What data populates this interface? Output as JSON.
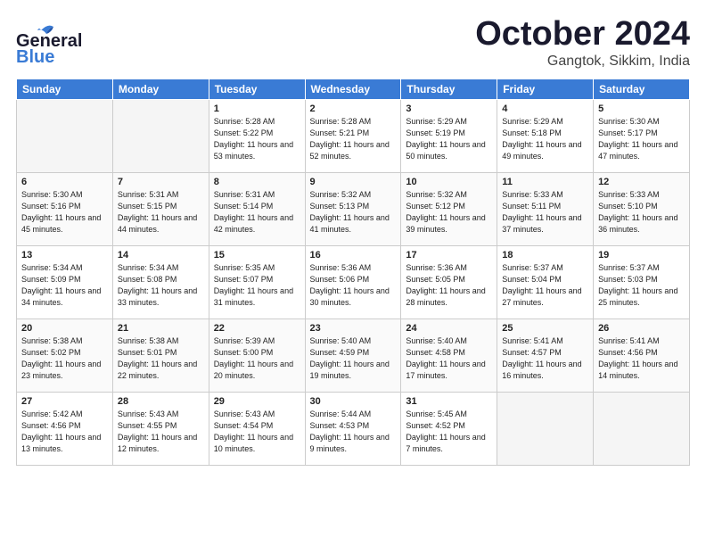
{
  "header": {
    "logo_general": "General",
    "logo_blue": "Blue",
    "month": "October 2024",
    "location": "Gangtok, Sikkim, India"
  },
  "weekdays": [
    "Sunday",
    "Monday",
    "Tuesday",
    "Wednesday",
    "Thursday",
    "Friday",
    "Saturday"
  ],
  "weeks": [
    [
      {
        "day": "",
        "empty": true
      },
      {
        "day": "",
        "empty": true
      },
      {
        "day": "1",
        "sunrise": "5:28 AM",
        "sunset": "5:22 PM",
        "daylight": "11 hours and 53 minutes."
      },
      {
        "day": "2",
        "sunrise": "5:28 AM",
        "sunset": "5:21 PM",
        "daylight": "11 hours and 52 minutes."
      },
      {
        "day": "3",
        "sunrise": "5:29 AM",
        "sunset": "5:19 PM",
        "daylight": "11 hours and 50 minutes."
      },
      {
        "day": "4",
        "sunrise": "5:29 AM",
        "sunset": "5:18 PM",
        "daylight": "11 hours and 49 minutes."
      },
      {
        "day": "5",
        "sunrise": "5:30 AM",
        "sunset": "5:17 PM",
        "daylight": "11 hours and 47 minutes."
      }
    ],
    [
      {
        "day": "6",
        "sunrise": "5:30 AM",
        "sunset": "5:16 PM",
        "daylight": "11 hours and 45 minutes."
      },
      {
        "day": "7",
        "sunrise": "5:31 AM",
        "sunset": "5:15 PM",
        "daylight": "11 hours and 44 minutes."
      },
      {
        "day": "8",
        "sunrise": "5:31 AM",
        "sunset": "5:14 PM",
        "daylight": "11 hours and 42 minutes."
      },
      {
        "day": "9",
        "sunrise": "5:32 AM",
        "sunset": "5:13 PM",
        "daylight": "11 hours and 41 minutes."
      },
      {
        "day": "10",
        "sunrise": "5:32 AM",
        "sunset": "5:12 PM",
        "daylight": "11 hours and 39 minutes."
      },
      {
        "day": "11",
        "sunrise": "5:33 AM",
        "sunset": "5:11 PM",
        "daylight": "11 hours and 37 minutes."
      },
      {
        "day": "12",
        "sunrise": "5:33 AM",
        "sunset": "5:10 PM",
        "daylight": "11 hours and 36 minutes."
      }
    ],
    [
      {
        "day": "13",
        "sunrise": "5:34 AM",
        "sunset": "5:09 PM",
        "daylight": "11 hours and 34 minutes."
      },
      {
        "day": "14",
        "sunrise": "5:34 AM",
        "sunset": "5:08 PM",
        "daylight": "11 hours and 33 minutes."
      },
      {
        "day": "15",
        "sunrise": "5:35 AM",
        "sunset": "5:07 PM",
        "daylight": "11 hours and 31 minutes."
      },
      {
        "day": "16",
        "sunrise": "5:36 AM",
        "sunset": "5:06 PM",
        "daylight": "11 hours and 30 minutes."
      },
      {
        "day": "17",
        "sunrise": "5:36 AM",
        "sunset": "5:05 PM",
        "daylight": "11 hours and 28 minutes."
      },
      {
        "day": "18",
        "sunrise": "5:37 AM",
        "sunset": "5:04 PM",
        "daylight": "11 hours and 27 minutes."
      },
      {
        "day": "19",
        "sunrise": "5:37 AM",
        "sunset": "5:03 PM",
        "daylight": "11 hours and 25 minutes."
      }
    ],
    [
      {
        "day": "20",
        "sunrise": "5:38 AM",
        "sunset": "5:02 PM",
        "daylight": "11 hours and 23 minutes."
      },
      {
        "day": "21",
        "sunrise": "5:38 AM",
        "sunset": "5:01 PM",
        "daylight": "11 hours and 22 minutes."
      },
      {
        "day": "22",
        "sunrise": "5:39 AM",
        "sunset": "5:00 PM",
        "daylight": "11 hours and 20 minutes."
      },
      {
        "day": "23",
        "sunrise": "5:40 AM",
        "sunset": "4:59 PM",
        "daylight": "11 hours and 19 minutes."
      },
      {
        "day": "24",
        "sunrise": "5:40 AM",
        "sunset": "4:58 PM",
        "daylight": "11 hours and 17 minutes."
      },
      {
        "day": "25",
        "sunrise": "5:41 AM",
        "sunset": "4:57 PM",
        "daylight": "11 hours and 16 minutes."
      },
      {
        "day": "26",
        "sunrise": "5:41 AM",
        "sunset": "4:56 PM",
        "daylight": "11 hours and 14 minutes."
      }
    ],
    [
      {
        "day": "27",
        "sunrise": "5:42 AM",
        "sunset": "4:56 PM",
        "daylight": "11 hours and 13 minutes."
      },
      {
        "day": "28",
        "sunrise": "5:43 AM",
        "sunset": "4:55 PM",
        "daylight": "11 hours and 12 minutes."
      },
      {
        "day": "29",
        "sunrise": "5:43 AM",
        "sunset": "4:54 PM",
        "daylight": "11 hours and 10 minutes."
      },
      {
        "day": "30",
        "sunrise": "5:44 AM",
        "sunset": "4:53 PM",
        "daylight": "11 hours and 9 minutes."
      },
      {
        "day": "31",
        "sunrise": "5:45 AM",
        "sunset": "4:52 PM",
        "daylight": "11 hours and 7 minutes."
      },
      {
        "day": "",
        "empty": true
      },
      {
        "day": "",
        "empty": true
      }
    ]
  ],
  "labels": {
    "sunrise": "Sunrise:",
    "sunset": "Sunset:",
    "daylight": "Daylight:"
  }
}
